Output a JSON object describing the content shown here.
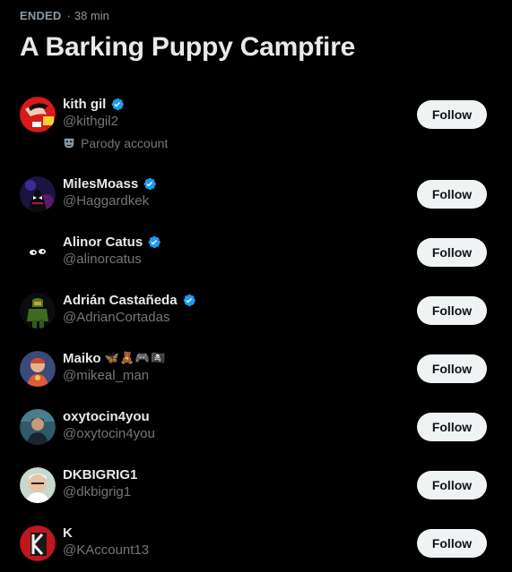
{
  "space": {
    "status": "ENDED",
    "separator": "·",
    "duration": "38 min",
    "title": "A Barking Puppy Campfire"
  },
  "colors": {
    "background": "#000000",
    "primary_text": "#e7e9ea",
    "secondary_text": "#71767b",
    "verified_blue": "#1d9bf0",
    "button_bg": "#eff3f4",
    "button_text": "#0f1419"
  },
  "follow_label": "Follow",
  "participants": [
    {
      "name": "kith gil",
      "handle": "@kithgil2",
      "verified": true,
      "label": "Parody account",
      "label_icon": "mask-icon"
    },
    {
      "name": "MilesMoass",
      "handle": "@Haggardkek",
      "verified": true
    },
    {
      "name": "Alinor Catus",
      "handle": "@alinorcatus",
      "verified": true
    },
    {
      "name": "Adrián Castañeda",
      "handle": "@AdrianCortadas",
      "verified": true
    },
    {
      "name": "Maiko",
      "name_emojis": "🦋🧸🎮🏴‍☠️",
      "handle": "@mikeal_man",
      "verified": false
    },
    {
      "name": "oxytocin4you",
      "handle": "@oxytocin4you",
      "verified": false
    },
    {
      "name": "DKBIGRIG1",
      "handle": "@dkbigrig1",
      "verified": false
    },
    {
      "name": "K",
      "handle": "@KAccount13",
      "verified": false
    }
  ]
}
